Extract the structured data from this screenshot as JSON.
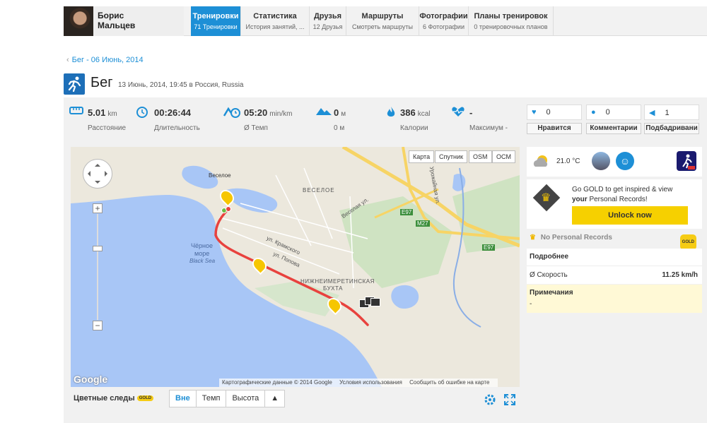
{
  "user": {
    "first_name": "Борис",
    "last_name": "Мальцев"
  },
  "nav": [
    {
      "title": "Тренировки",
      "sub": "71 Тренировки",
      "active": true
    },
    {
      "title": "Статистика",
      "sub": "История занятий, ...",
      "active": false
    },
    {
      "title": "Друзья",
      "sub": "12 Друзья",
      "active": false
    },
    {
      "title": "Маршруты",
      "sub": "Смотреть маршруты",
      "active": false
    },
    {
      "title": "Фотографии",
      "sub": "6 Фотографии",
      "active": false
    },
    {
      "title": "Планы тренировок",
      "sub": "0 тренировочных планов",
      "active": false
    }
  ],
  "breadcrumb": "Бег - 06 Июнь, 2014",
  "title": {
    "sport": "Бег",
    "subtitle": "13 Июнь, 2014, 19:45 в Россия, Russia"
  },
  "stats": {
    "distance": {
      "value": "5.01",
      "unit": "km",
      "label": "Расстояние"
    },
    "duration": {
      "value": "00:26:44",
      "label": "Длительность"
    },
    "pace": {
      "value": "05:20",
      "unit": "min/km",
      "label": "Ø Темп"
    },
    "elevation": {
      "value": "0",
      "unit": "м",
      "sub": "0 м"
    },
    "calories": {
      "value": "386",
      "unit": "kcal",
      "label": "Калории"
    },
    "heart": {
      "value": "-",
      "label": "Максимум -"
    }
  },
  "social": {
    "likes": {
      "count": "0",
      "label": "Нравится"
    },
    "comments": {
      "count": "0",
      "label": "Комментарии"
    },
    "cheers": {
      "count": "1",
      "label": "Подбадривани"
    }
  },
  "map": {
    "types": [
      "Карта",
      "Спутник",
      "OSM",
      "OCM"
    ],
    "labels": {
      "veseloe_village": "Веселое",
      "veseloe": "ВЕСЕЛОЕ",
      "veselaya_st": "Веселая ул.",
      "sea1": "Чёрное",
      "sea2": "море",
      "sea3": "Black Sea",
      "bay1": "НИЖНЕИМЕРЕТИНСКАЯ",
      "bay2": "БУХТА",
      "kramskogo": "ул. Крамского",
      "popova": "ул. Попова",
      "urozh": "Урожайная ул.",
      "e97a": "E97",
      "e97b": "E97",
      "m27": "M27"
    },
    "markers": {
      "k1": "1\nkm",
      "k2": "2\nkm",
      "k3": "3\nkm"
    },
    "credit": [
      "Картографические данные © 2014 Google",
      "Условия использования",
      "Сообщить об ошибке на карте"
    ],
    "logo": "Google",
    "zoom_in": "+",
    "zoom_out": "−"
  },
  "trails": {
    "title": "Цветные следы",
    "badge": "GOLD",
    "options": [
      "Вне",
      "Темп",
      "Высота",
      "▲"
    ]
  },
  "weather": {
    "temp": "21.0 °C"
  },
  "gold_promo": {
    "line1": "Go GOLD to get inspired & view",
    "bold": "your",
    "line2": " Personal Records!",
    "button": "Unlock now"
  },
  "records": {
    "text": "No Personal Records",
    "badge": "GOLD"
  },
  "details": {
    "title": "Подробнее",
    "label": "Ø Скорость",
    "value": "11.25 km/h"
  },
  "notes": {
    "title": "Примечания",
    "text": "-"
  }
}
